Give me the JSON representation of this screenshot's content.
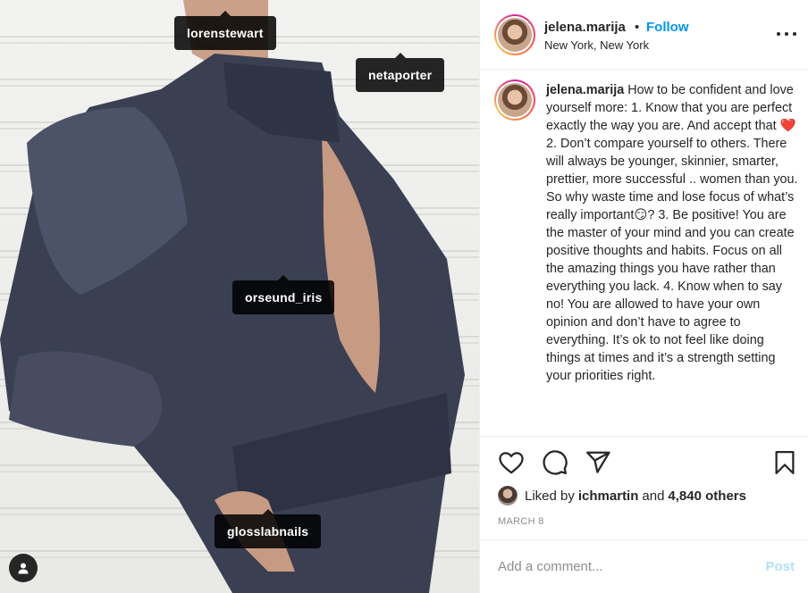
{
  "photo": {
    "tags": [
      "lorenstewart",
      "netaporter",
      "orseund_iris",
      "glosslabnails"
    ]
  },
  "header": {
    "username": "jelena.marija",
    "separator": "•",
    "follow_label": "Follow",
    "location": "New York, New York"
  },
  "caption": {
    "username": "jelena.marija",
    "text": "How to be confident and love yourself more: 1. Know that you are perfect exactly the way you are. And accept that ❤️ 2. Don’t compare yourself to others. There will always be younger, skinnier, smarter, prettier, more successful .. women than you. So why waste time and lose focus of what’s really important😏? 3. Be positive! You are the master of your mind and you can create positive thoughts and habits. Focus on all the amazing things you have rather than everything you lack. 4. Know when to say no! You are allowed to have your own opinion and don’t have to agree to everything. It’s ok to not feel like doing things at times and it’s a strength setting your priorities right."
  },
  "likes": {
    "prefix": "Liked by",
    "user": "ichmartin",
    "and": "and",
    "others": "4,840 others"
  },
  "date": "MARCH 8",
  "comment": {
    "placeholder": "Add a comment...",
    "post_label": "Post"
  },
  "colors": {
    "link_blue": "#0095f6",
    "post_disabled": "#b2dffc",
    "muted": "#8e8e8e"
  },
  "icons": [
    "heart-icon",
    "comment-icon",
    "share-icon",
    "bookmark-icon",
    "more-icon",
    "user-tag-icon"
  ]
}
